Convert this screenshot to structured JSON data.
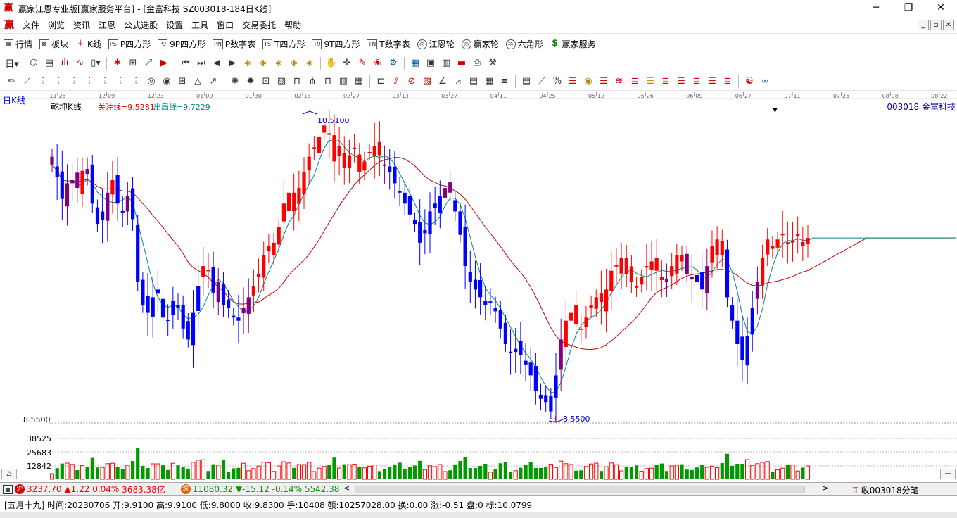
{
  "window": {
    "title": "赢家江恩专业版[赢家服务平台] - [金富科技   SZ003018-184日K线]",
    "controls": [
      "─",
      "❐",
      "✕"
    ]
  },
  "menu": [
    "文件",
    "浏览",
    "资讯",
    "江恩",
    "公式选股",
    "设置",
    "工具",
    "窗口",
    "交易委托",
    "帮助"
  ],
  "toolbar1": [
    {
      "label": "行情",
      "icon": "grid-icon"
    },
    {
      "label": "板块",
      "icon": "blocks-icon"
    },
    {
      "label": "K线",
      "icon": "candle-icon"
    },
    {
      "label": "P四方形",
      "icon": "ps-icon",
      "glyph": "PS"
    },
    {
      "label": "9P四方形",
      "icon": "p9-icon",
      "glyph": "P9"
    },
    {
      "label": "P数字表",
      "icon": "pn-icon",
      "glyph": "PN"
    },
    {
      "label": "T四方形",
      "icon": "ts-icon",
      "glyph": "TS"
    },
    {
      "label": "9T四方形",
      "icon": "t9-icon",
      "glyph": "T9"
    },
    {
      "label": "T数字表",
      "icon": "tn-icon",
      "glyph": "TN"
    },
    {
      "label": "江恩轮",
      "icon": "gann-wheel-icon",
      "glyph": "◎"
    },
    {
      "label": "赢家轮",
      "icon": "winner-wheel-icon",
      "glyph": "◎"
    },
    {
      "label": "六角形",
      "icon": "hexagon-icon",
      "glyph": "◎"
    },
    {
      "label": "赢家服务",
      "icon": "dollar-icon",
      "glyph": "$"
    }
  ],
  "chart": {
    "period_label": "日K线",
    "indicator_name": "乾坤K线",
    "focus_line": "关注线=9.5281",
    "exit_line": "出局线=9.7229",
    "stock_label": "003018  金富科技",
    "high_label": "10.5100",
    "low_label": "8.5500",
    "price_axis_label": "8.5500",
    "volume_labels": [
      "38525",
      "25683",
      "12842"
    ],
    "dates": [
      "11-25",
      "12-09",
      "12-23",
      "01-09",
      "01-30",
      "02-13",
      "02-27",
      "03-13",
      "03-27",
      "04-11",
      "04-25",
      "05-12",
      "05-26",
      "06-09",
      "06-27",
      "07-11",
      "07-25",
      "08-08",
      "08-22"
    ],
    "colors": {
      "up": "#ff0000",
      "down": "#0000ff",
      "neutral": "#800080",
      "volume": "#009900",
      "ma_slow": "#cc0000",
      "ma_fast": "#008b8b"
    }
  },
  "chart_data": {
    "type": "candlestick",
    "closes": [
      10.2,
      10.12,
      9.98,
      10.08,
      10.1,
      10.05,
      10.16,
      10.14,
      9.95,
      9.82,
      9.9,
      10.02,
      10.1,
      9.95,
      9.9,
      10.0,
      9.85,
      9.45,
      9.3,
      9.25,
      9.35,
      9.4,
      9.22,
      9.2,
      9.33,
      9.3,
      9.15,
      9.08,
      9.25,
      9.42,
      9.55,
      9.52,
      9.38,
      9.45,
      9.3,
      9.28,
      9.22,
      9.2,
      9.28,
      9.35,
      9.42,
      9.5,
      9.62,
      9.68,
      9.7,
      9.8,
      9.95,
      10.02,
      9.9,
      10.05,
      10.15,
      10.25,
      10.3,
      10.38,
      10.45,
      10.4,
      10.22,
      10.32,
      10.18,
      10.26,
      10.3,
      10.15,
      10.22,
      10.28,
      10.32,
      10.26,
      10.2,
      10.15,
      10.08,
      10.02,
      9.95,
      9.88,
      9.82,
      9.7,
      9.78,
      9.9,
      9.95,
      10.0,
      10.05,
      10.02,
      9.9,
      9.75,
      9.55,
      9.45,
      9.4,
      9.35,
      9.3,
      9.32,
      9.28,
      9.15,
      9.05,
      9.0,
      9.02,
      8.98,
      8.92,
      8.85,
      8.75,
      8.7,
      8.68,
      8.72,
      8.85,
      9.08,
      9.2,
      9.25,
      9.18,
      9.15,
      9.22,
      9.3,
      9.35,
      9.32,
      9.4,
      9.52,
      9.55,
      9.6,
      9.5,
      9.45,
      9.42,
      9.48,
      9.55,
      9.58,
      9.52,
      9.48,
      9.45,
      9.55,
      9.62,
      9.58,
      9.5,
      9.48,
      9.45,
      9.4,
      9.55,
      9.68,
      9.72,
      9.62,
      9.35,
      9.2,
      9.05,
      8.95,
      9.1,
      9.28,
      9.45,
      9.6,
      9.72,
      9.68,
      9.72,
      9.75,
      9.7,
      9.71,
      9.74,
      9.68,
      9.73
    ],
    "ylim": [
      8.55,
      10.51
    ]
  },
  "indexbar": {
    "sh_value": "3237.70",
    "sh_change": "▲1.22 0.04%",
    "sh_amount": "3683.38亿",
    "sz_badge": "深",
    "sz_value": "11080.32",
    "sz_change": "▼-15.12 -0.14%",
    "sz_amount": "5542.38",
    "collect": "收003018分笔"
  },
  "statusbar": "[五月十九] 时间:20230706 开:9.9100 高:9.9100 低:9.8000 收:9.8300 手:10408 额:10257028.00 换:0.00 涨:-0.51 盘:0 标:10.0799"
}
